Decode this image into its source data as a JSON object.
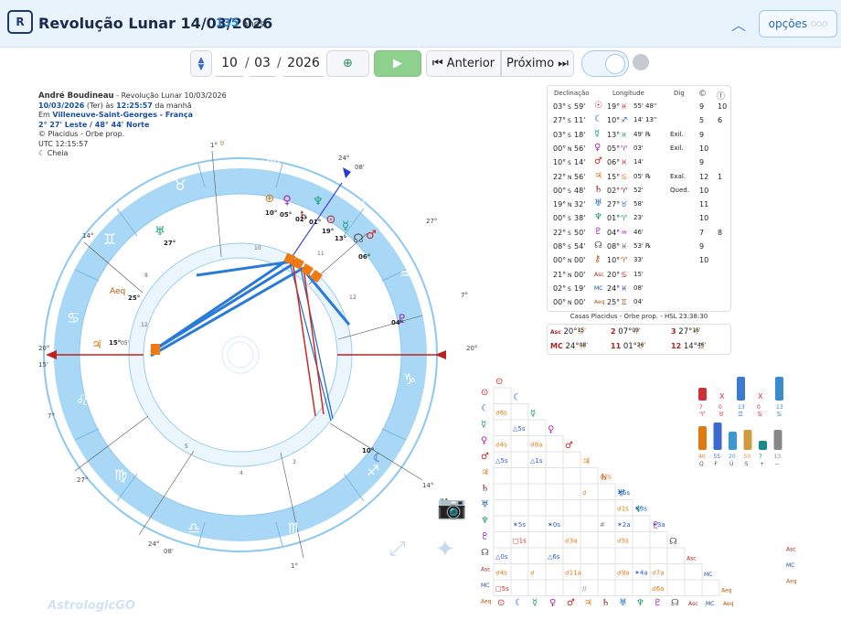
{
  "header": {
    "title": "Revolução Lunar 14/03/2026",
    "years_num": "135",
    "years_label": "anos",
    "options": "opções",
    "options_dots": "○○○",
    "logo": "R"
  },
  "toolbar": {
    "day": "10",
    "month": "03",
    "year": "2026",
    "prev": "Anterior",
    "next": "Próximo"
  },
  "info": {
    "line1_name": "André Boudineau",
    "line1_rest": " - Revolução Lunar 10/03/2026",
    "line2_date": "10/03/2026",
    "line2_mid": " (Ter) às ",
    "line2_time": "12:25:57",
    "line2_end": " da manhã",
    "line3_pre": "Em ",
    "line3_place": "Villeneuve-Saint-Georges - França",
    "line4": "2° 27' Leste / 48° 44' Norte",
    "line5": "Placidus - Orbe prop.",
    "line6": "UTC 12:15:57",
    "line7": "Cheia"
  },
  "table": {
    "headers": {
      "decl": "Declinação",
      "lon": "Longitude",
      "dig": "Dig"
    },
    "rows": [
      {
        "d": "03°",
        "m": "59'",
        "ns": "S",
        "g": "☉",
        "c": "#d0202a",
        "lon": "19°",
        "sg": "♓",
        "min": "55' 48''",
        "dig": "",
        "a": "9",
        "b": "10"
      },
      {
        "d": "27°",
        "m": "11'",
        "ns": "S",
        "g": "☾",
        "c": "#2a5bd0",
        "lon": "10°",
        "sg": "♐",
        "min": "14' 13''",
        "dig": "",
        "a": "5",
        "b": "6"
      },
      {
        "d": "03°",
        "m": "18'",
        "ns": "S",
        "g": "☿",
        "c": "#1a9a7a",
        "lon": "13°",
        "sg": "♓",
        "min": "49' ℞",
        "dig": "Exil.",
        "a": "9",
        "b": ""
      },
      {
        "d": "00°",
        "m": "56'",
        "ns": "N",
        "g": "♀",
        "c": "#b020b0",
        "lon": "05°",
        "sg": "♈",
        "min": "03'",
        "dig": "Exil.",
        "a": "10",
        "b": ""
      },
      {
        "d": "10°",
        "m": "14'",
        "ns": "S",
        "g": "♂",
        "c": "#d0202a",
        "lon": "06°",
        "sg": "♓",
        "min": "14'",
        "dig": "",
        "a": "9",
        "b": ""
      },
      {
        "d": "22°",
        "m": "56'",
        "ns": "N",
        "g": "♃",
        "c": "#e07a10",
        "lon": "15°",
        "sg": "♋",
        "min": "05' ℞",
        "dig": "Exal.",
        "a": "12",
        "b": "1"
      },
      {
        "d": "00°",
        "m": "48'",
        "ns": "S",
        "g": "♄",
        "c": "#8a2020",
        "lon": "02°",
        "sg": "♈",
        "min": "52'",
        "dig": "Qued.",
        "a": "10",
        "b": ""
      },
      {
        "d": "19°",
        "m": "32'",
        "ns": "N",
        "g": "♅",
        "c": "#1a6ad0",
        "lon": "27°",
        "sg": "♉",
        "min": "58'",
        "dig": "",
        "a": "11",
        "b": ""
      },
      {
        "d": "00°",
        "m": "38'",
        "ns": "S",
        "g": "♆",
        "c": "#1a9a7a",
        "lon": "01°",
        "sg": "♈",
        "min": "23'",
        "dig": "",
        "a": "10",
        "b": ""
      },
      {
        "d": "22°",
        "m": "50'",
        "ns": "S",
        "g": "♇",
        "c": "#9a20b0",
        "lon": "04°",
        "sg": "♒",
        "min": "46'",
        "dig": "",
        "a": "7",
        "b": "8"
      },
      {
        "d": "08°",
        "m": "54'",
        "ns": "S",
        "g": "☊",
        "c": "#555",
        "lon": "08°",
        "sg": "♓",
        "min": "53' ℞",
        "dig": "",
        "a": "9",
        "b": ""
      },
      {
        "d": "00°",
        "m": "00'",
        "ns": "N",
        "g": "⚷",
        "c": "#c05a10",
        "lon": "10°",
        "sg": "♈",
        "min": "33'",
        "dig": "",
        "a": "10",
        "b": ""
      },
      {
        "d": "21°",
        "m": "00'",
        "ns": "N",
        "g": "Asc",
        "c": "#b02020",
        "lon": "20°",
        "sg": "♋",
        "min": "15'",
        "dig": "",
        "a": "",
        "b": ""
      },
      {
        "d": "02°",
        "m": "19'",
        "ns": "S",
        "g": "MC",
        "c": "#1a4ea0",
        "lon": "24°",
        "sg": "♓",
        "min": "08'",
        "dig": "",
        "a": "",
        "b": ""
      },
      {
        "d": "00°",
        "m": "00'",
        "ns": "N",
        "g": "Aeq",
        "c": "#b05a10",
        "lon": "25°",
        "sg": "♊",
        "min": "04'",
        "dig": "",
        "a": "",
        "b": ""
      }
    ]
  },
  "casas": {
    "title": "Casas Placidus - Orbe prop. - HSL 23:38:30",
    "c": [
      {
        "l": "Asc",
        "v": "20°",
        "s": "♋",
        "m": "15'"
      },
      {
        "l": "2",
        "v": "07°",
        "s": "♌",
        "m": "09'"
      },
      {
        "l": "3",
        "v": "27°",
        "s": "♌",
        "m": "16'"
      },
      {
        "l": "MC",
        "v": "24°",
        "s": "♓",
        "m": "08'"
      },
      {
        "l": "11",
        "v": "01°",
        "s": "♉",
        "m": "26'"
      },
      {
        "l": "12",
        "v": "14°",
        "s": "♊",
        "m": "46'"
      }
    ]
  },
  "bars": {
    "top": [
      {
        "v": "7",
        "l": "♈",
        "c": "#d0303a"
      },
      {
        "v": "X",
        "l": "♉",
        "c": "#d0303a"
      },
      {
        "v": "13",
        "l": "♊",
        "c": "#3a7ad0"
      },
      {
        "v": "X",
        "l": "♋",
        "c": "#d0303a"
      },
      {
        "v": "13",
        "l": "♋",
        "c": "#3a8ad0"
      }
    ],
    "topv": [
      "7",
      "0",
      "13",
      "0",
      "13"
    ],
    "bot": [
      {
        "v": "40",
        "l": "Q",
        "c": "#e07a10"
      },
      {
        "v": "55",
        "l": "F",
        "c": "#3a6ad0"
      },
      {
        "v": "20",
        "l": "Ú",
        "c": "#3a9ad0"
      },
      {
        "v": "50",
        "l": "S",
        "c": "#d09a40"
      },
      {
        "v": "7",
        "l": "+",
        "c": "#1a8a8a"
      },
      {
        "v": "13",
        "l": "−",
        "c": "#888"
      }
    ]
  },
  "chart_labels": {
    "asc": "20°",
    "asc_m": "15'",
    "dsc": "20°",
    "dsc_m": "15'",
    "mc": "24°",
    "ic": "24°",
    "jupiter": "15°",
    "jup_m": "05'"
  },
  "watermark": "AstrologicGO"
}
